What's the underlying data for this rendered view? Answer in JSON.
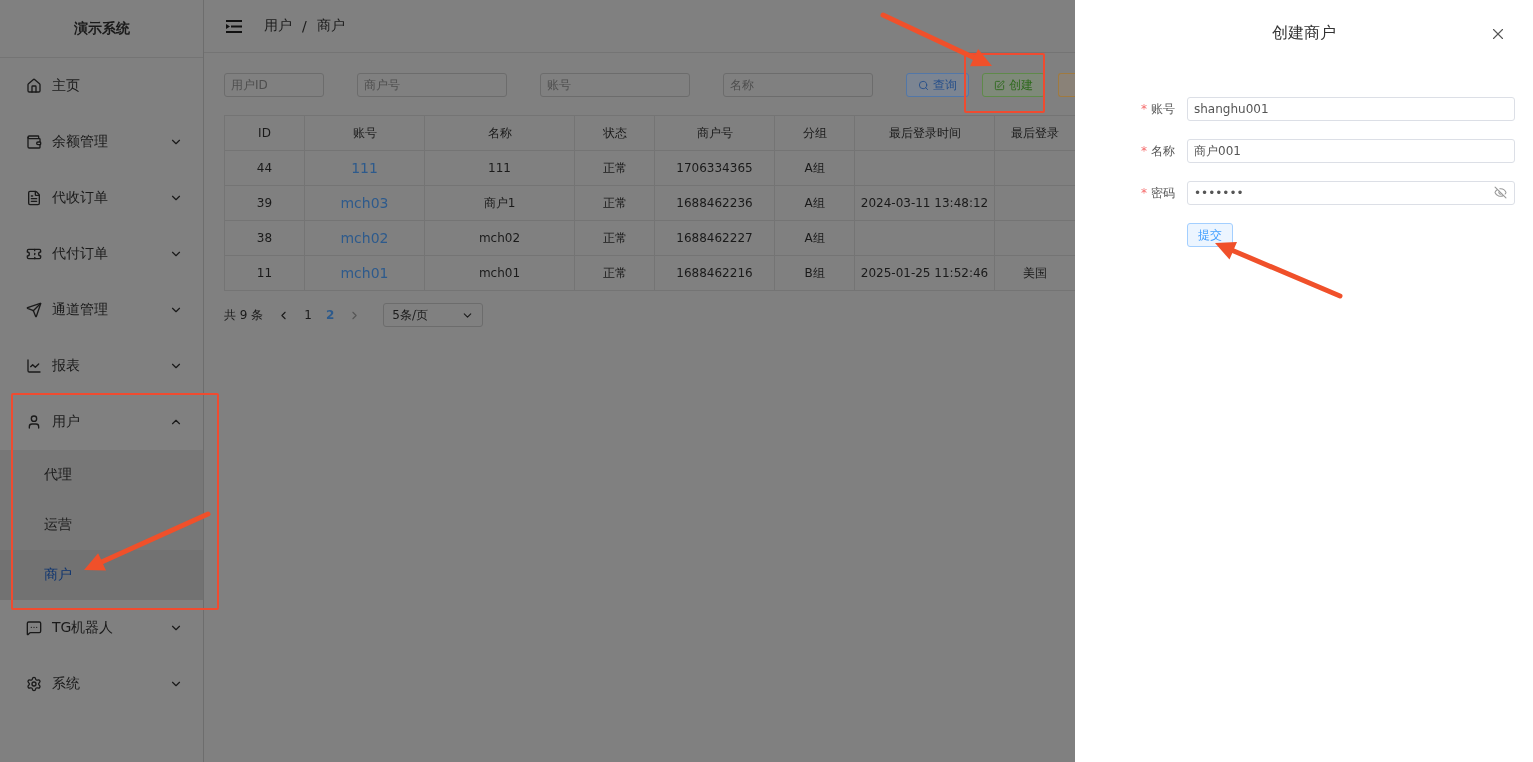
{
  "sidebar": {
    "title": "演示系统",
    "items": [
      {
        "label": "主页",
        "kind": "link"
      },
      {
        "label": "余额管理",
        "kind": "group",
        "expanded": false
      },
      {
        "label": "代收订单",
        "kind": "group",
        "expanded": false
      },
      {
        "label": "代付订单",
        "kind": "group",
        "expanded": false
      },
      {
        "label": "通道管理",
        "kind": "group",
        "expanded": false
      },
      {
        "label": "报表",
        "kind": "group",
        "expanded": false
      },
      {
        "label": "用户",
        "kind": "group",
        "expanded": true,
        "children": [
          {
            "label": "代理",
            "selected": false
          },
          {
            "label": "运营",
            "selected": false
          },
          {
            "label": "商户",
            "selected": true
          }
        ]
      },
      {
        "label": "TG机器人",
        "kind": "group",
        "expanded": false
      },
      {
        "label": "系统",
        "kind": "group",
        "expanded": false
      }
    ]
  },
  "header": {
    "breadcrumb": [
      "用户",
      "商户"
    ],
    "separator": "/"
  },
  "filters": [
    {
      "placeholder": "用户ID"
    },
    {
      "placeholder": "商户号"
    },
    {
      "placeholder": "账号"
    },
    {
      "placeholder": "名称"
    }
  ],
  "actions": [
    {
      "label": "查询",
      "kind": "search"
    },
    {
      "label": "创建",
      "kind": "create"
    }
  ],
  "table": {
    "columns": [
      "ID",
      "账号",
      "名称",
      "状态",
      "商户号",
      "分组",
      "最后登录时间",
      "最后登录"
    ],
    "rows": [
      [
        "44",
        "111",
        "111",
        "正常",
        "1706334365",
        "A组",
        "",
        ""
      ],
      [
        "39",
        "mch03",
        "商户1",
        "正常",
        "1688462236",
        "A组",
        "2024-03-11 13:48:12",
        ""
      ],
      [
        "38",
        "mch02",
        "mch02",
        "正常",
        "1688462227",
        "A组",
        "",
        ""
      ],
      [
        "11",
        "mch01",
        "mch01",
        "正常",
        "1688462216",
        "B组",
        "2025-01-25 11:52:46",
        "美国"
      ]
    ]
  },
  "pagination": {
    "total": "共 9 条",
    "pages": [
      {
        "label": "1",
        "selected": false
      },
      {
        "label": "2",
        "selected": true
      }
    ],
    "page_size": "5条/页"
  },
  "drawer": {
    "title": "创建商户",
    "required_mark": "*",
    "fields": [
      {
        "label": "账号",
        "required": true,
        "value": "shanghu001",
        "kind": "text"
      },
      {
        "label": "名称",
        "required": true,
        "value": "商户001",
        "kind": "text"
      },
      {
        "label": "密码",
        "required": true,
        "value": "•••••••",
        "kind": "password"
      }
    ],
    "submit": "提交"
  }
}
